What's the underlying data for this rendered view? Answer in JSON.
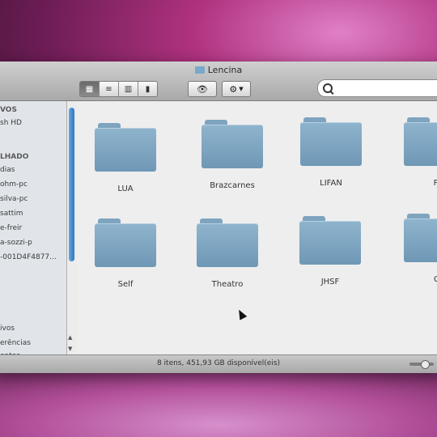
{
  "window": {
    "title": "Lencina"
  },
  "toolbar": {
    "view_buttons": [
      "icon-view",
      "list-view",
      "column-view",
      "cover-flow-view"
    ],
    "active_view": "icon-view",
    "quicklook_icon": "eye-icon",
    "action_icon": "gear-icon",
    "search_placeholder": ""
  },
  "sidebar": {
    "items": [
      {
        "label": "VOS"
      },
      {
        "label": "sh HD"
      },
      {
        "label": "LHADO"
      },
      {
        "label": "dias"
      },
      {
        "label": "ohm-pc"
      },
      {
        "label": "silva-pc"
      },
      {
        "label": "sattim"
      },
      {
        "label": "e-freir"
      },
      {
        "label": "a-sozzi-p"
      },
      {
        "label": "-001D4F4877..."
      },
      {
        "label": "ivos"
      },
      {
        "label": "erências"
      },
      {
        "label": "entos"
      }
    ]
  },
  "folders": [
    {
      "name": "LUA"
    },
    {
      "name": "Brazcarnes"
    },
    {
      "name": "LIFAN"
    },
    {
      "name": "PM"
    },
    {
      "name": "Self"
    },
    {
      "name": "Theatro"
    },
    {
      "name": "JHSF"
    },
    {
      "name": "GE"
    }
  ],
  "status": {
    "text": "8 itens, 451,93 GB disponível(eis)"
  },
  "colors": {
    "folder": "#7ea4bf",
    "scroll_thumb": "#3a84cc"
  }
}
